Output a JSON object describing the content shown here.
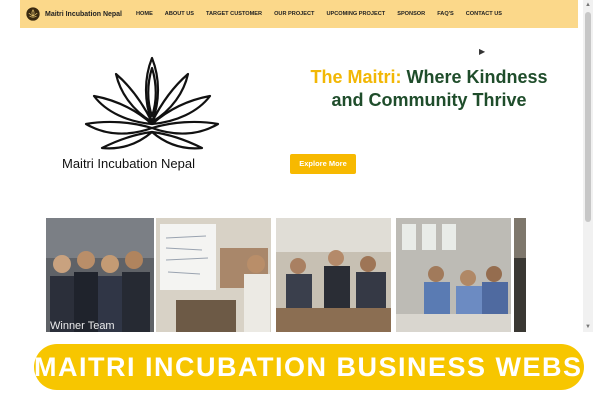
{
  "navbar": {
    "brand_name": "Maitri Incubation Nepal",
    "logo_icon": "lotus-icon",
    "links": [
      "HOME",
      "ABOUT US",
      "TARGET CUSTOMER",
      "OUR PROJECT",
      "UPCOMING PROJECT",
      "SPONSOR",
      "FAQ'S",
      "CONTACT US"
    ]
  },
  "hero": {
    "logo_text": "Maitri Incubation Nepal",
    "headline_accent": "The Maitri:",
    "headline_rest": "Where Kindness and Community Thrive",
    "cta_label": "Explore More"
  },
  "gallery": {
    "first_caption": "Winner Team"
  },
  "banner": {
    "text": "MAITRI INCUBATION BUSINESS WEBSITE"
  },
  "colors": {
    "nav_background": "#fbd88a",
    "accent_yellow": "#f7b900",
    "headline_green": "#1f4d2b",
    "banner_yellow": "#f7c600"
  }
}
